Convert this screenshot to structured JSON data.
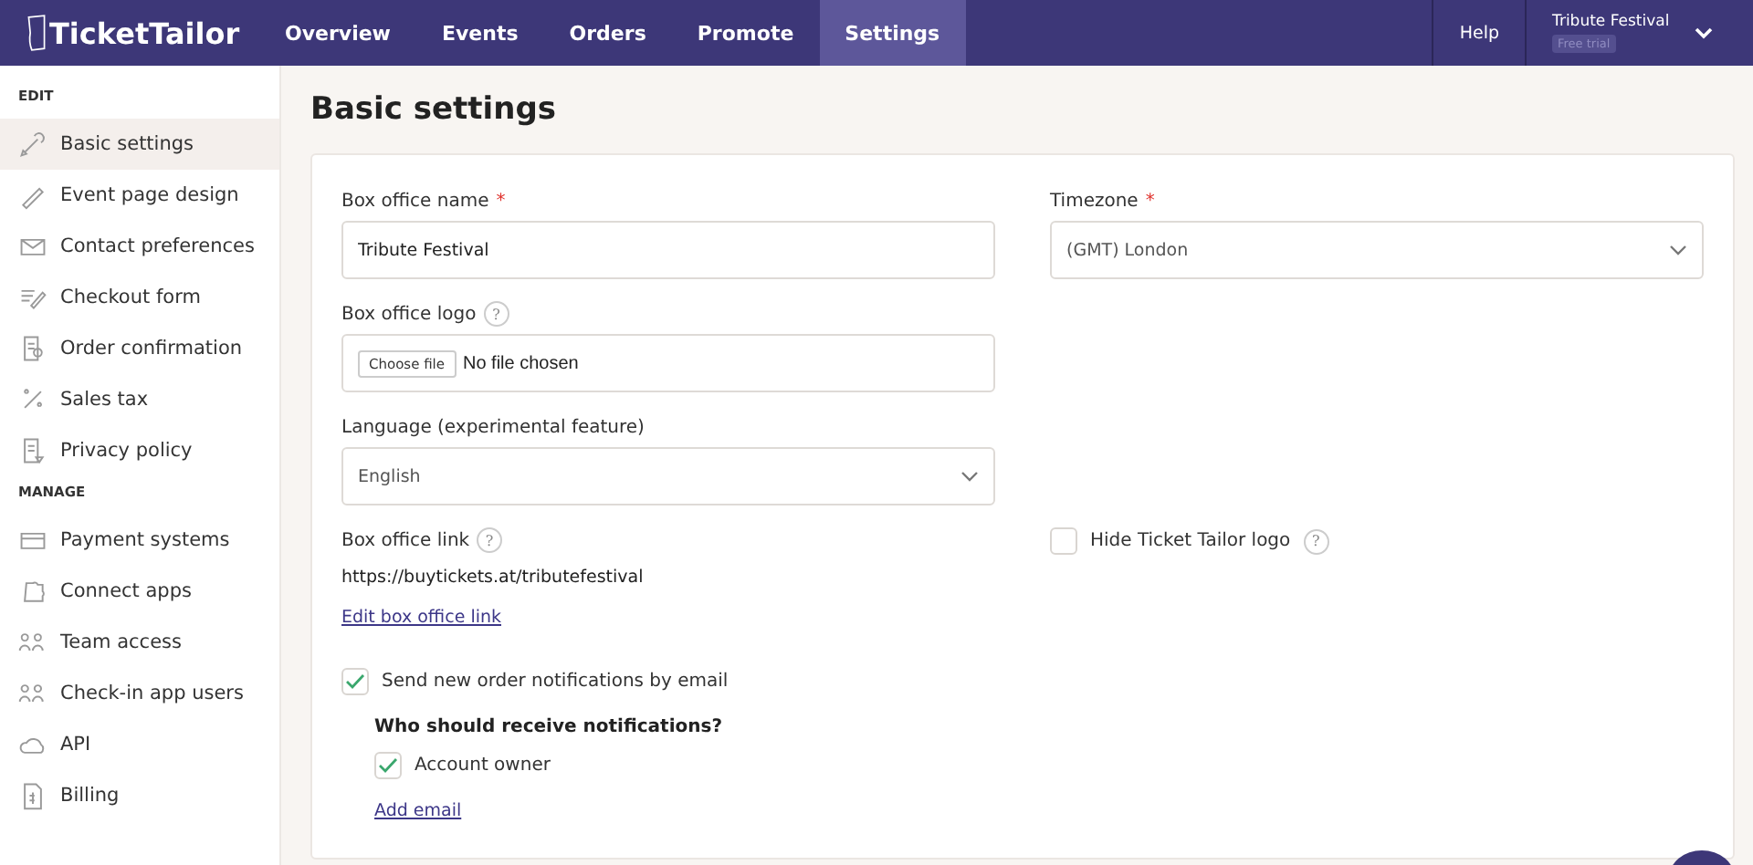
{
  "topbar": {
    "logo": "TicketTailor",
    "tabs": [
      {
        "label": "Overview",
        "selected": false
      },
      {
        "label": "Events",
        "selected": false
      },
      {
        "label": "Orders",
        "selected": false
      },
      {
        "label": "Promote",
        "selected": false
      },
      {
        "label": "Settings",
        "selected": true
      }
    ],
    "help": "Help",
    "account": {
      "name": "Tribute Festival",
      "badge": "Free trial"
    }
  },
  "sidebar": {
    "sections": [
      {
        "heading": "EDIT",
        "items": [
          {
            "label": "Basic settings",
            "selected": true
          },
          {
            "label": "Event page design",
            "selected": false
          },
          {
            "label": "Contact preferences",
            "selected": false
          },
          {
            "label": "Checkout form",
            "selected": false
          },
          {
            "label": "Order confirmation",
            "selected": false
          },
          {
            "label": "Sales tax",
            "selected": false
          },
          {
            "label": "Privacy policy",
            "selected": false
          }
        ]
      },
      {
        "heading": "MANAGE",
        "items": [
          {
            "label": "Payment systems",
            "selected": false
          },
          {
            "label": "Connect apps",
            "selected": false
          },
          {
            "label": "Team access",
            "selected": false
          },
          {
            "label": "Check-in app users",
            "selected": false
          },
          {
            "label": "API",
            "selected": false
          },
          {
            "label": "Billing",
            "selected": false
          }
        ]
      }
    ]
  },
  "page": {
    "title": "Basic settings",
    "box_office_name": {
      "label": "Box office name",
      "required_mark": "*",
      "value": "Tribute Festival"
    },
    "timezone": {
      "label": "Timezone",
      "required_mark": "*",
      "value": "(GMT) London"
    },
    "box_office_logo": {
      "label": "Box office logo",
      "hint": "?",
      "button": "Choose file",
      "status": "No file chosen"
    },
    "language": {
      "label": "Language (experimental feature)",
      "value": "English"
    },
    "box_office_link": {
      "label": "Box office link",
      "hint": "?",
      "url": "https://buytickets.at/tributefestival",
      "edit_link": "Edit box office link"
    },
    "hide_logo": {
      "label": "Hide Ticket Tailor logo",
      "hint": "?",
      "checked": false
    },
    "notifications": {
      "label": "Send new order notifications by email",
      "checked": true,
      "heading": "Who should receive notifications?",
      "recipients": [
        {
          "label": "Account owner",
          "checked": true
        }
      ],
      "add_link": "Add email"
    }
  }
}
